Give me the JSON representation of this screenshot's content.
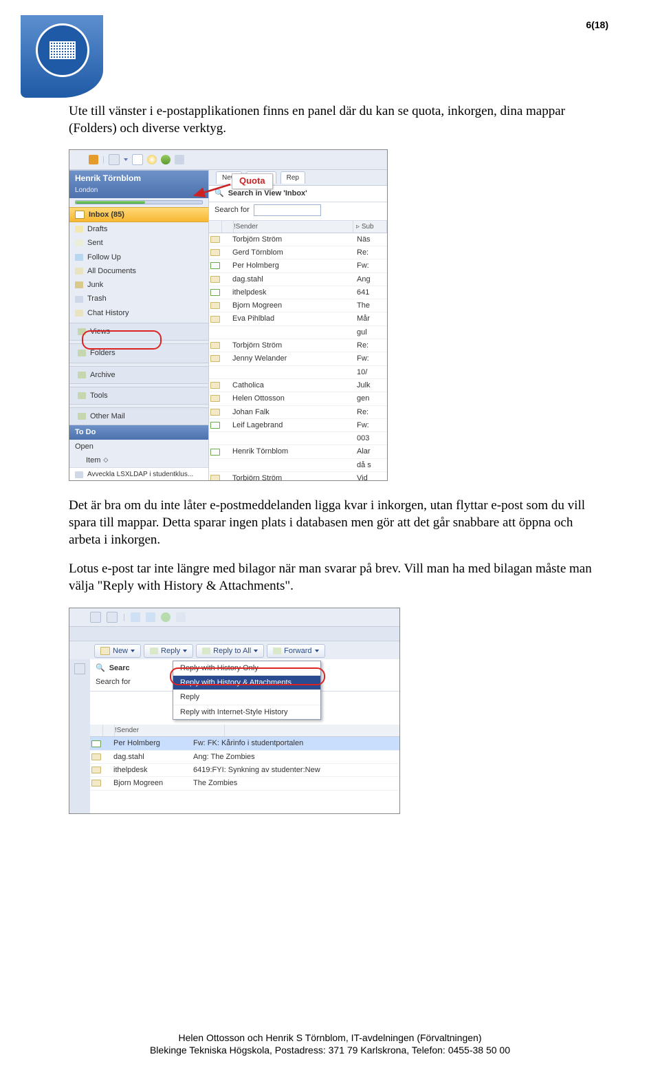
{
  "page_number": "6(18)",
  "paragraphs": {
    "p1": "Ute till vänster i e-postapplikationen finns en panel där du kan se quota, inkorgen, dina mappar (Folders) och diverse verktyg.",
    "p2": "Det är bra om du inte låter e-postmeddelanden ligga kvar i inkorgen, utan flyttar e-post som du vill spara till mappar. Detta sparar ingen plats i databasen men gör att det går snabbare att öppna och arbeta i inkorgen.",
    "p3": "Lotus e-post tar inte längre med bilagor när man svarar på brev. Vill man ha med bilagan måste man välja \"Reply with History & Attachments\"."
  },
  "screenshot1": {
    "callout": "Quota",
    "user_name": "Henrik Törnblom",
    "user_location": "London",
    "inbox_label": "Inbox (85)",
    "side_items": [
      "Drafts",
      "Sent",
      "Follow Up",
      "All Documents",
      "Junk",
      "Trash",
      "Chat History"
    ],
    "side_groups": [
      "Views",
      "Folders",
      "Archive",
      "Tools",
      "Other Mail"
    ],
    "todo_header": "To Do",
    "todo_items": [
      "Open",
      "Item"
    ],
    "todo_footer": "Avveckla LSXLDAP i studentklus...",
    "toolbar_tabs": [
      "New",
      "Reply",
      "Rep"
    ],
    "search_label": "Search in View 'Inbox'",
    "search_for": "Search for",
    "grid_headers": [
      "",
      "",
      "!Sender",
      "Sub"
    ],
    "rows": [
      {
        "sender": "Torbjörn Ström",
        "sub": "Näs"
      },
      {
        "sender": "Gerd Törnblom",
        "sub": "Re:"
      },
      {
        "sender": "Per Holmberg",
        "sub": "Fw:",
        "unread": true
      },
      {
        "sender": "dag.stahl",
        "sub": "Ang"
      },
      {
        "sender": "ithelpdesk",
        "sub": "641",
        "unread": true
      },
      {
        "sender": "Bjorn Mogreen",
        "sub": "The"
      },
      {
        "sender": "Eva Pihlblad",
        "sub": "Mår"
      },
      {
        "sender": "",
        "sub": "gul"
      },
      {
        "sender": "Torbjörn Ström",
        "sub": "Re:"
      },
      {
        "sender": "Jenny Welander",
        "sub": "Fw:"
      },
      {
        "sender": "",
        "sub": "10/"
      },
      {
        "sender": "Catholica",
        "sub": "Julk"
      },
      {
        "sender": "Helen Ottosson",
        "sub": "gen"
      },
      {
        "sender": "Johan Falk",
        "sub": "Re:"
      },
      {
        "sender": "Leif Lagebrand",
        "sub": "Fw:",
        "unread": true
      },
      {
        "sender": "",
        "sub": "003"
      },
      {
        "sender": "Henrik Törnblom",
        "sub": "Alar",
        "unread": true
      },
      {
        "sender": "",
        "sub": "då s"
      },
      {
        "sender": "Torbjörn Ström",
        "sub": "Vid"
      }
    ]
  },
  "screenshot2": {
    "toolbar": {
      "new": "New",
      "reply": "Reply",
      "reply_all": "Reply to All",
      "forward": "Forward"
    },
    "menu_items": [
      "Reply with History Only",
      "Reply with History & Attachments",
      "Reply",
      "Reply with Internet-Style History"
    ],
    "menu_selected_index": 1,
    "search_prefix": "Searc",
    "search_for": "Search for",
    "grid_headers": [
      "",
      "",
      "!Sender"
    ],
    "rows": [
      {
        "sender": "Per Holmberg",
        "subject": "Fw: FK: Kårinfo i studentportalen",
        "unread": true,
        "selected": true
      },
      {
        "sender": "dag.stahl",
        "subject": "Ang: The Zombies"
      },
      {
        "sender": "ithelpdesk",
        "subject": "6419:FYI: Synkning av studenter:New"
      },
      {
        "sender": "Bjorn Mogreen",
        "subject": "The Zombies"
      }
    ]
  },
  "footer": {
    "line1": "Helen Ottosson och Henrik S Törnblom, IT-avdelningen (Förvaltningen)",
    "line2": "Blekinge Tekniska Högskola, Postadress: 371 79 Karlskrona, Telefon: 0455-38 50 00"
  }
}
